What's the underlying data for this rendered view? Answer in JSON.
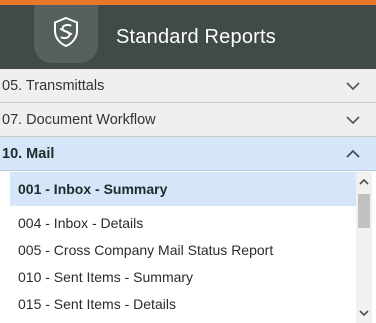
{
  "header": {
    "title": "Standard Reports",
    "logo_icon": "shield-logo-icon"
  },
  "colors": {
    "accent": "#e8772e",
    "header_bg": "#3f4a49",
    "selected_bg": "#d4e6f8",
    "section_bg": "#efefef"
  },
  "sections": [
    {
      "label": "05. Transmittals",
      "state": "collapsed",
      "icon": "chevron-down-icon"
    },
    {
      "label": "07. Document Workflow",
      "state": "collapsed",
      "icon": "chevron-down-icon"
    },
    {
      "label": "10. Mail",
      "state": "expanded",
      "icon": "chevron-up-icon"
    }
  ],
  "mail_reports": {
    "items": [
      {
        "label": "001 - Inbox - Summary",
        "selected": true
      },
      {
        "label": "004 - Inbox - Details",
        "selected": false
      },
      {
        "label": "005 - Cross Company Mail Status Report",
        "selected": false
      },
      {
        "label": "010 - Sent Items - Summary",
        "selected": false
      },
      {
        "label": "015 - Sent Items - Details",
        "selected": false
      }
    ]
  }
}
